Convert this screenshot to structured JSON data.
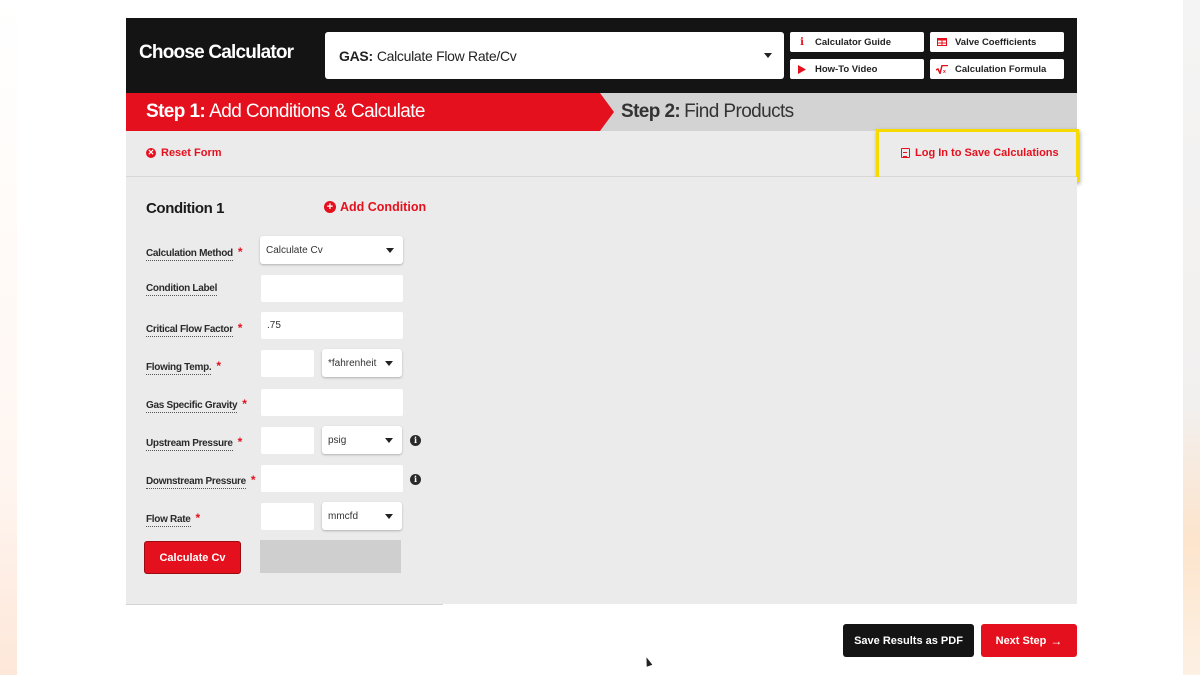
{
  "header": {
    "title": "Choose Calculator",
    "calculator_select": {
      "prefix": "GAS:",
      "value": "Calculate Flow Rate/Cv"
    },
    "buttons": [
      {
        "label": "Calculator Guide",
        "icon": "info-icon"
      },
      {
        "label": "Valve Coefficients",
        "icon": "table-icon"
      },
      {
        "label": "How-To Video",
        "icon": "play-icon"
      },
      {
        "label": "Calculation Formula",
        "icon": "square-root-icon"
      }
    ]
  },
  "steps": [
    {
      "prefix": "Step 1:",
      "label": "Add Conditions & Calculate",
      "active": true
    },
    {
      "prefix": "Step 2:",
      "label": "Find Products",
      "active": false
    }
  ],
  "toolbar": {
    "reset_label": "Reset Form",
    "login_label": "Log In to Save Calculations"
  },
  "condition": {
    "title": "Condition 1",
    "add_label": "Add Condition",
    "fields": {
      "calculation_method": {
        "label": "Calculation Method",
        "required": "*",
        "value": "Calculate Cv"
      },
      "condition_label": {
        "label": "Condition Label",
        "value": ""
      },
      "critical_flow_factor": {
        "label": "Critical Flow Factor",
        "required": "*",
        "value": ".75"
      },
      "flowing_temp": {
        "label": "Flowing Temp.",
        "required": "*",
        "value": "",
        "unit": "*fahrenheit"
      },
      "gas_specific_gravity": {
        "label": "Gas Specific Gravity",
        "required": "*",
        "value": ""
      },
      "upstream_pressure": {
        "label": "Upstream Pressure",
        "required": "*",
        "value": "",
        "unit": "psig"
      },
      "downstream_pressure": {
        "label": "Downstream Pressure",
        "required": "*",
        "value": ""
      },
      "flow_rate": {
        "label": "Flow Rate",
        "required": "*",
        "value": "",
        "unit": "mmcfd"
      }
    },
    "calculate_label": "Calculate Cv",
    "result": ""
  },
  "footer": {
    "pdf_label": "Save Results as PDF",
    "next_label": "Next Step",
    "next_arrow": "→"
  },
  "colors": {
    "brand_red": "#e5101d",
    "header_black": "#141414",
    "highlight_yellow": "#f7da00"
  }
}
